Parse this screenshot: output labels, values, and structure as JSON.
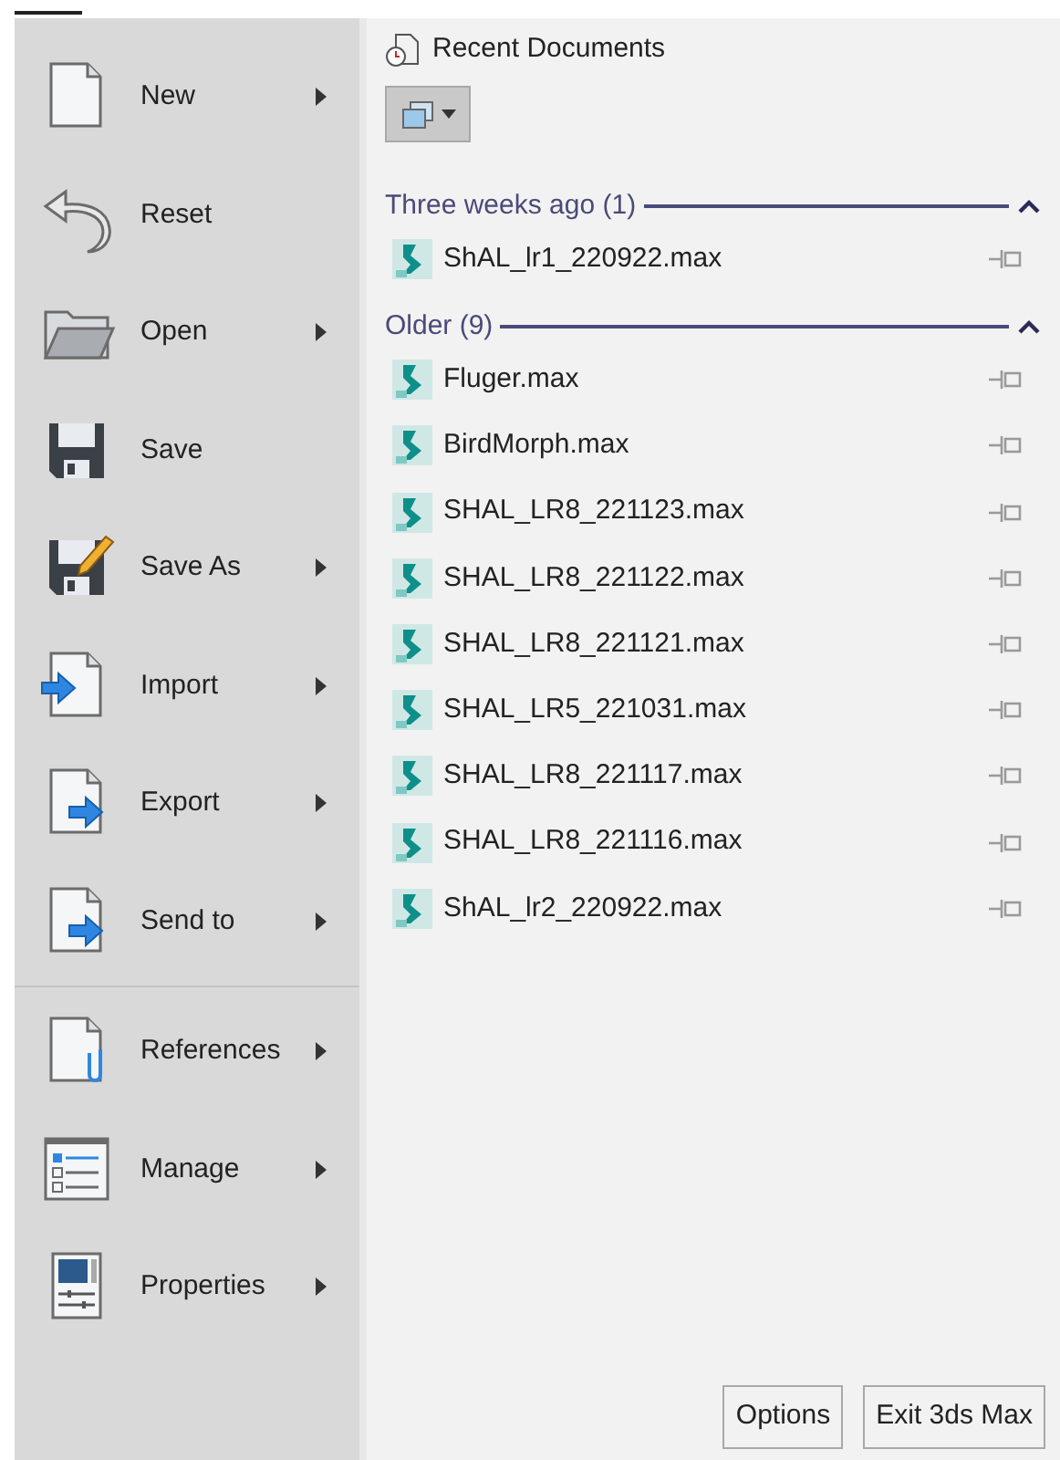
{
  "menu_groups": [
    [
      {
        "label": "New",
        "has_submenu": true
      },
      {
        "label": "Reset",
        "has_submenu": false
      },
      {
        "label": "Open",
        "has_submenu": true
      },
      {
        "label": "Save",
        "has_submenu": false
      },
      {
        "label": "Save As",
        "has_submenu": true
      },
      {
        "label": "Import",
        "has_submenu": true
      },
      {
        "label": "Export",
        "has_submenu": true
      },
      {
        "label": "Send to",
        "has_submenu": true
      }
    ],
    [
      {
        "label": "References",
        "has_submenu": true
      },
      {
        "label": "Manage",
        "has_submenu": true
      },
      {
        "label": "Properties",
        "has_submenu": true
      }
    ]
  ],
  "recent": {
    "title": "Recent Documents",
    "groups": [
      {
        "title": "Three weeks ago (1)",
        "expanded": true,
        "files": [
          {
            "name": "ShAL_lr1_220922.max",
            "pinned": false
          }
        ]
      },
      {
        "title": "Older (9)",
        "expanded": true,
        "files": [
          {
            "name": "Fluger.max",
            "pinned": false
          },
          {
            "name": "BirdMorph.max",
            "pinned": false
          },
          {
            "name": "SHAL_LR8_221123.max",
            "pinned": false
          },
          {
            "name": "SHAL_LR8_221122.max",
            "pinned": false
          },
          {
            "name": "SHAL_LR8_221121.max",
            "pinned": false
          },
          {
            "name": "SHAL_LR5_221031.max",
            "pinned": false
          },
          {
            "name": "SHAL_LR8_221117.max",
            "pinned": false
          },
          {
            "name": "SHAL_LR8_221116.max",
            "pinned": false
          },
          {
            "name": "ShAL_lr2_220922.max",
            "pinned": false
          }
        ]
      }
    ]
  },
  "buttons": [
    "Options",
    "Exit 3ds Max"
  ]
}
